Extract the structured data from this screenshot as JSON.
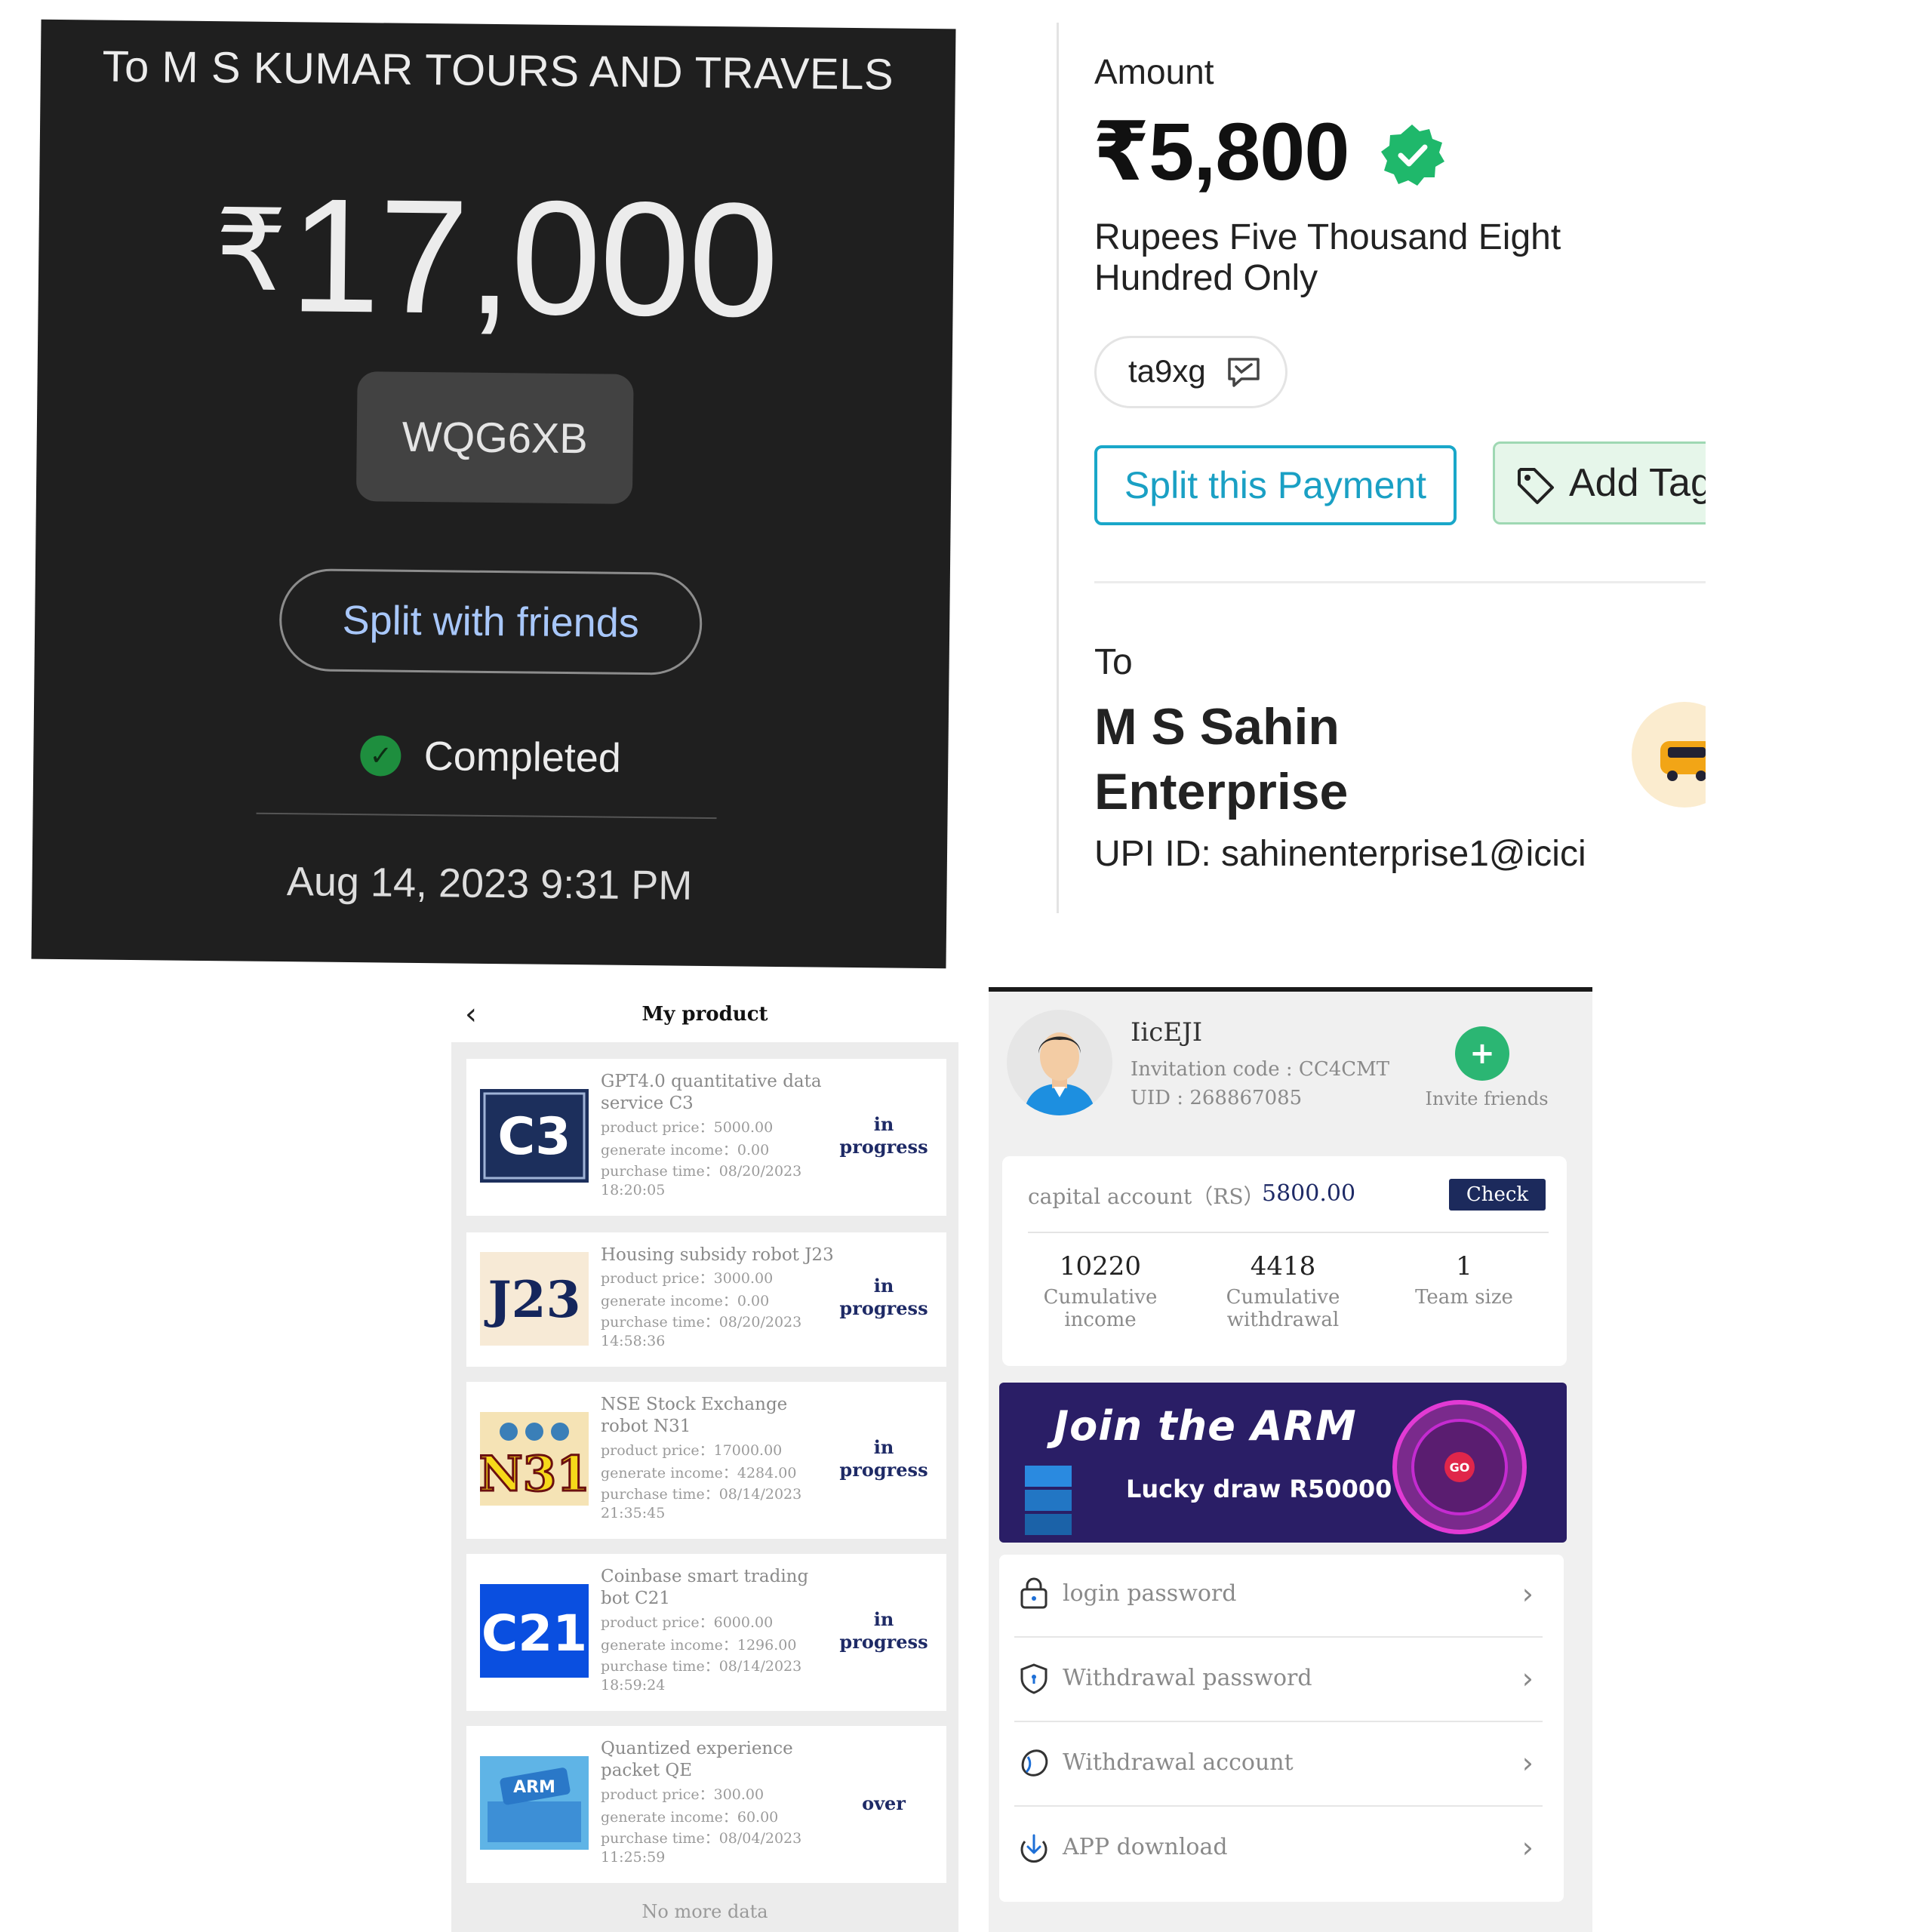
{
  "panel1": {
    "to_line": "To M S KUMAR TOURS AND TRAVELS",
    "currency": "₹",
    "amount": "17,000",
    "txn_code": "WQG6XB",
    "split_label": "Split with friends",
    "status": "Completed",
    "datetime": "Aug 14, 2023 9:31 PM",
    "colors": {
      "background": "#1f1f1f",
      "link": "#a8c7fa",
      "success": "#1e8e3e"
    }
  },
  "panel2": {
    "amount_label": "Amount",
    "amount": "₹5,800",
    "amount_words": "Rupees Five Thousand Eight Hundred Only",
    "note": "ta9xg",
    "note_icon": "message-icon",
    "split_button": "Split this Payment",
    "tag_button": "Add Tag",
    "to_label": "To",
    "payee": "M S Sahin Enterprise",
    "upi": "UPI ID: sahinenterprise1@icici",
    "colors": {
      "accent": "#19a7c9",
      "verified": "#1fb86b",
      "tag_bg": "#e6f6ea"
    }
  },
  "panel3": {
    "title": "My product",
    "back_icon": "chevron-left-icon",
    "products": [
      {
        "thumb": "C3",
        "name": "GPT4.0 quantitative data service C3",
        "price": "product price：5000.00",
        "income": "generate income：0.00",
        "time": "purchase time：08/20/2023",
        "time2": "18:20:05",
        "status": "in progress"
      },
      {
        "thumb": "J23",
        "name": "Housing subsidy robot J23",
        "price": "product price：3000.00",
        "income": "generate income：0.00",
        "time": "purchase time：08/20/2023",
        "time2": "14:58:36",
        "status": "in progress"
      },
      {
        "thumb": "N31",
        "name": "NSE Stock Exchange robot N31",
        "price": "product price：17000.00",
        "income": "generate income：4284.00",
        "time": "purchase time：08/14/2023",
        "time2": "21:35:45",
        "status": "in progress"
      },
      {
        "thumb": "C21",
        "name": "Coinbase smart trading bot C21",
        "price": "product price：6000.00",
        "income": "generate income：1296.00",
        "time": "purchase time：08/14/2023",
        "time2": "18:59:24",
        "status": "in progress"
      },
      {
        "thumb": "ARM",
        "name": "Quantized experience packet QE",
        "price": "product price：300.00",
        "income": "generate income：60.00",
        "time": "purchase time：08/04/2023",
        "time2": "11:25:59",
        "status": "over"
      }
    ],
    "footer": "No more data",
    "colors": {
      "status": "#1e2a66"
    }
  },
  "panel4": {
    "username": "IicEJI",
    "invitation": "Invitation code : CC4CMT",
    "uid": "UID : 268867085",
    "invite_label": "Invite friends",
    "capital_label": "capital account（RS）",
    "capital_value": "5800.00",
    "check_button": "Check",
    "stats": [
      {
        "value": "10220",
        "label": "Cumulative income"
      },
      {
        "value": "4418",
        "label": "Cumulative withdrawal"
      },
      {
        "value": "1",
        "label": "Team size"
      }
    ],
    "banner_title": "Join the ARM",
    "banner_sub": "Lucky draw R50000",
    "banner_wheel": "GO",
    "menu": [
      {
        "label": "login password",
        "icon": "lock-icon"
      },
      {
        "label": "Withdrawal password",
        "icon": "shield-icon"
      },
      {
        "label": "Withdrawal account",
        "icon": "wallet-icon"
      },
      {
        "label": "APP download",
        "icon": "download-icon"
      }
    ],
    "colors": {
      "navy": "#1c2a5c",
      "invite": "#2bb673"
    }
  }
}
